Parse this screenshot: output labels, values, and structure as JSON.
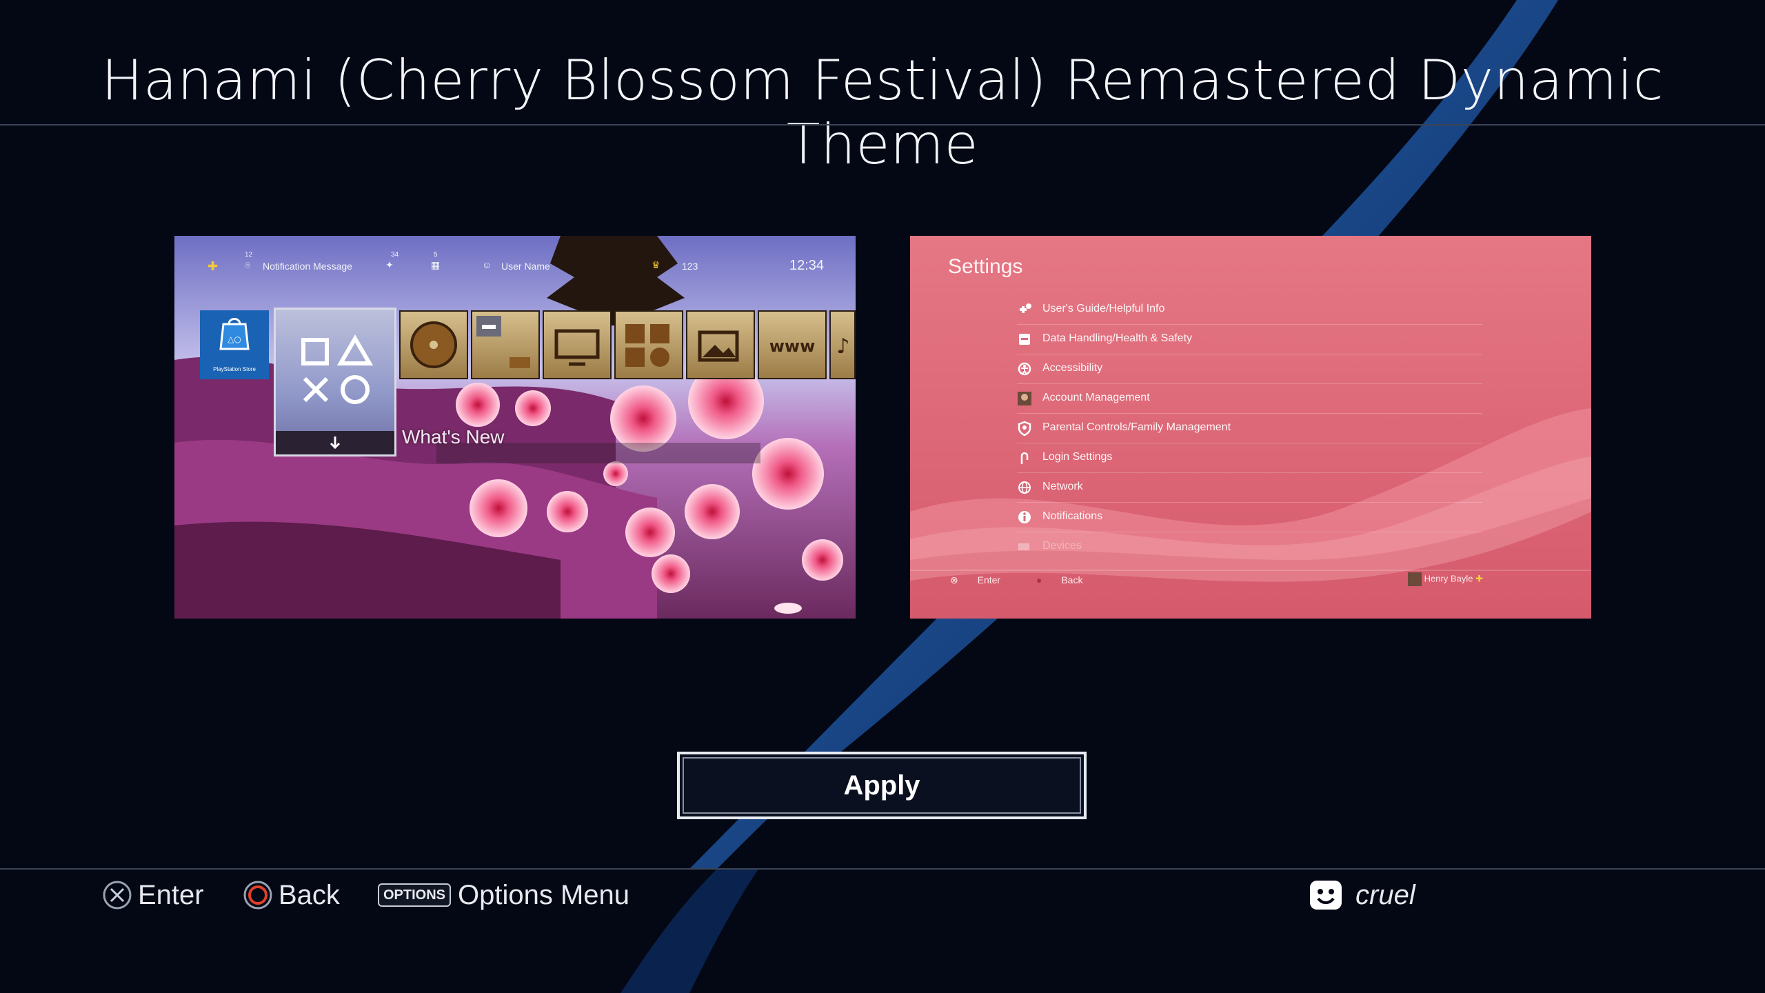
{
  "page": {
    "title": "Hanami (Cherry Blossom Festival) Remastered Dynamic Theme"
  },
  "home_preview": {
    "notification": "Notification Message",
    "notification_count": "12",
    "friends_count": "34",
    "messages_count": "5",
    "user_name": "User Name",
    "trophy_count": "123",
    "clock": "12:34",
    "store_label": "PlayStation Store",
    "focus_label": "What's New",
    "icons": [
      "ps-store-icon",
      "ps-symbols-icon",
      "disc-icon",
      "controller-folder-icon",
      "tv-icon",
      "library-icon",
      "gallery-icon",
      "www-icon",
      "music-icon"
    ]
  },
  "settings_preview": {
    "title": "Settings",
    "items": [
      {
        "label": "User's Guide/Helpful Info",
        "icon": "help-icon"
      },
      {
        "label": "Data Handling/Health & Safety",
        "icon": "data-icon"
      },
      {
        "label": "Accessibility",
        "icon": "accessibility-icon"
      },
      {
        "label": "Account Management",
        "icon": "account-icon"
      },
      {
        "label": "Parental Controls/Family Management",
        "icon": "parental-icon"
      },
      {
        "label": "Login Settings",
        "icon": "login-icon"
      },
      {
        "label": "Network",
        "icon": "network-icon"
      },
      {
        "label": "Notifications",
        "icon": "notifications-icon"
      },
      {
        "label": "Devices",
        "icon": "devices-icon"
      }
    ],
    "footer_enter": "Enter",
    "footer_back": "Back",
    "footer_user": "Henry Bayle"
  },
  "apply_label": "Apply",
  "bottom_bar": {
    "enter": "Enter",
    "back": "Back",
    "options_badge": "OPTIONS",
    "options": "Options Menu",
    "user": "cruel"
  },
  "colors": {
    "background": "#040815",
    "wave": "#1c56a8",
    "settings_bg": "#e06f80",
    "circle_button": "#e04028"
  }
}
